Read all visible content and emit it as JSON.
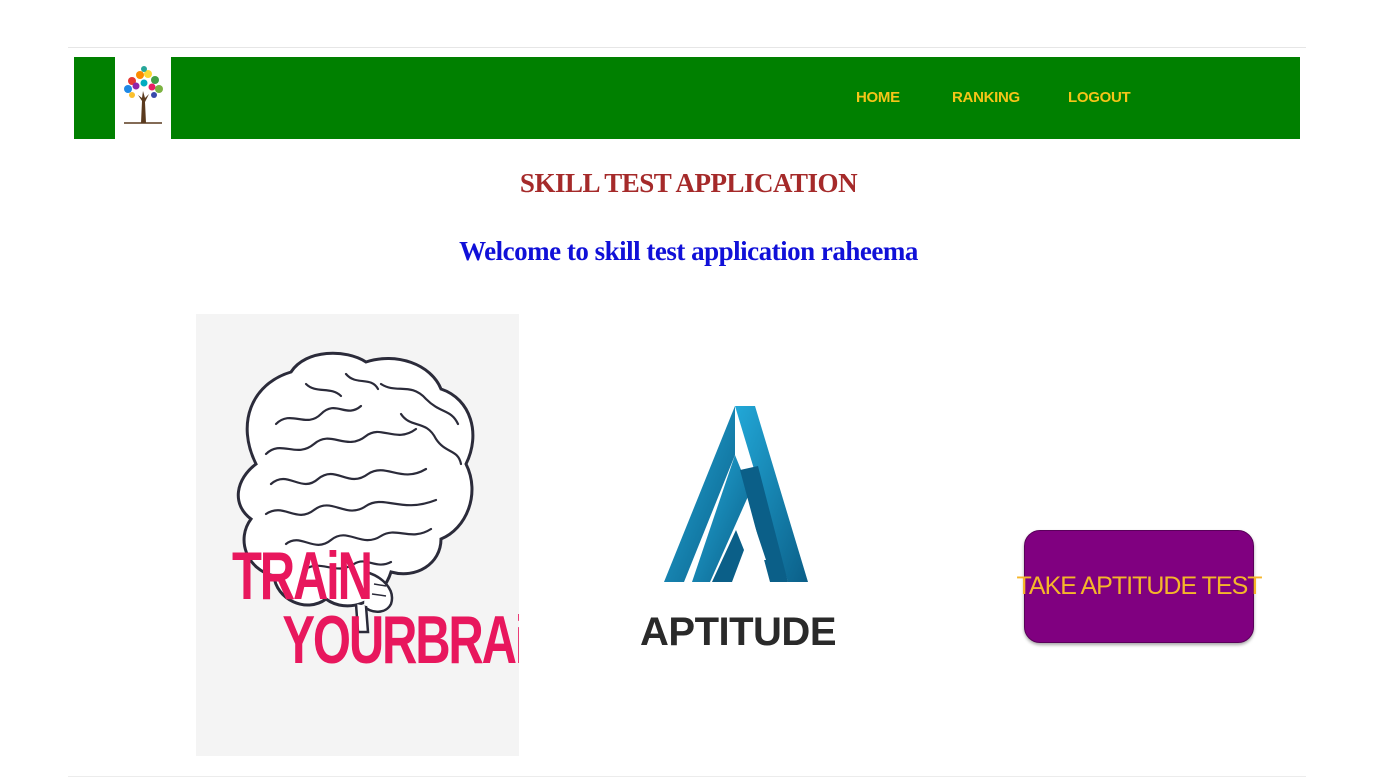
{
  "nav": {
    "logo_name": "tree-logo",
    "links": [
      {
        "label": "HOME"
      },
      {
        "label": "RANKING"
      },
      {
        "label": "LOGOUT"
      }
    ],
    "bar_color": "#008000",
    "link_color": "#f5c518"
  },
  "main": {
    "title": "SKILL TEST APPLICATION",
    "welcome": "Welcome to skill test application raheema",
    "brain_image": {
      "line1": "TRAiN",
      "line2": "YOURBRAiN"
    },
    "aptitude_logo": {
      "word": "APTITUDE"
    },
    "take_test_button": "TAKE APTITUDE TEST"
  },
  "colors": {
    "title": "#a52a2a",
    "welcome": "#1010d8",
    "button_bg": "#800080",
    "button_text": "#f5b62a",
    "brain_text": "#e8175d",
    "aptitude_blue": "#1a8fc4"
  }
}
